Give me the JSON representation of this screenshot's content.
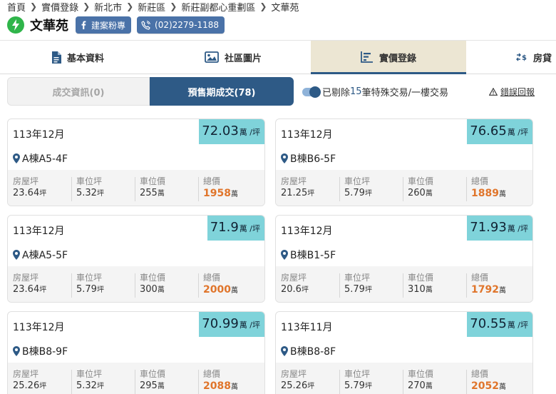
{
  "breadcrumb": [
    "首頁",
    "實價登錄",
    "新北市",
    "新莊區",
    "新莊副都心重劃區",
    "文華苑"
  ],
  "title": "文華苑",
  "actions": {
    "fanpage": "建案粉專",
    "phone": "(02)2279-1188"
  },
  "tabs": [
    {
      "label": "基本資料",
      "icon": "document-icon"
    },
    {
      "label": "社區圖片",
      "icon": "image-icon"
    },
    {
      "label": "實價登錄",
      "icon": "chart-icon",
      "active": true
    },
    {
      "label": "房貸",
      "icon": "dollar-exchange-icon"
    }
  ],
  "segments": {
    "completed": "成交資訊(0)",
    "presale": "預售期成交(78)"
  },
  "filter": {
    "prefix": "已剔除",
    "count": "15",
    "suffix": "筆特殊交易/一樓交易"
  },
  "report": "錯誤回報",
  "stat_labels": {
    "house": "房屋坪",
    "parking": "車位坪",
    "parking_price": "車位價",
    "total": "總價"
  },
  "units": {
    "price": "萬 /坪",
    "ping": "坪",
    "wan": "萬"
  },
  "colors": {
    "primary": "#2e5a86",
    "badge": "#7fd3da",
    "total": "#e0752b",
    "bolt": "#2fb54a",
    "pill": "#4a72a8"
  },
  "cards": [
    {
      "date": "113年12月",
      "price": "72.03",
      "unit": "A棟A5-4F",
      "house": "23.64",
      "parking": "5.32",
      "parking_price": "255",
      "total": "1958"
    },
    {
      "date": "113年12月",
      "price": "76.65",
      "unit": "B棟B6-5F",
      "house": "21.25",
      "parking": "5.79",
      "parking_price": "260",
      "total": "1889"
    },
    {
      "date": "113年12月",
      "price": "71.9",
      "unit": "A棟A5-5F",
      "house": "23.64",
      "parking": "5.79",
      "parking_price": "300",
      "total": "2000"
    },
    {
      "date": "113年12月",
      "price": "71.93",
      "unit": "B棟B1-5F",
      "house": "20.6",
      "parking": "5.79",
      "parking_price": "310",
      "total": "1792"
    },
    {
      "date": "113年12月",
      "price": "70.99",
      "unit": "B棟B8-9F",
      "house": "25.26",
      "parking": "5.32",
      "parking_price": "295",
      "total": "2088"
    },
    {
      "date": "113年11月",
      "price": "70.55",
      "unit": "B棟B8-8F",
      "house": "25.26",
      "parking": "5.79",
      "parking_price": "270",
      "total": "2052"
    }
  ]
}
